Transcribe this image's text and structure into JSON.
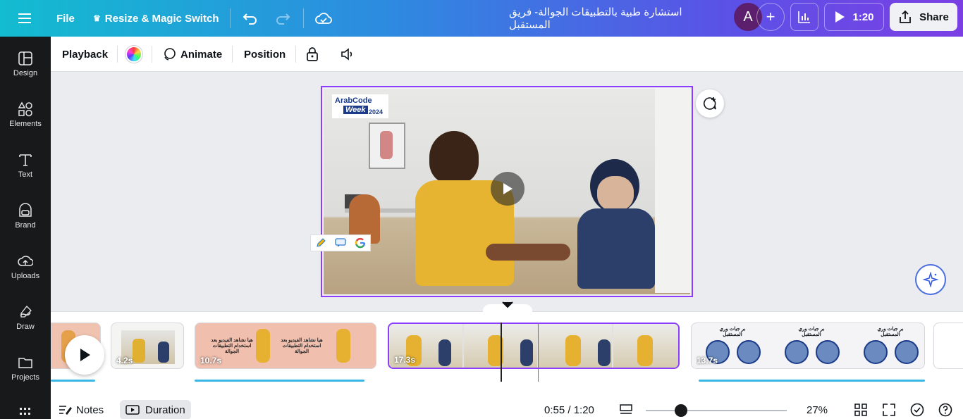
{
  "topbar": {
    "menu_icon": "hamburger-icon",
    "file_label": "File",
    "resize_label": "Resize & Magic Switch",
    "design_title": "استشارة طبية بالتطبيقات الجوالة- فريق المستقبل",
    "avatar_letter": "A",
    "play_time": "1:20",
    "share_label": "Share",
    "gradient_start": "#13bcd0",
    "gradient_end": "#7b3fe4"
  },
  "sidebar": {
    "items": [
      {
        "label": "Design",
        "icon": "design-icon"
      },
      {
        "label": "Elements",
        "icon": "elements-icon"
      },
      {
        "label": "Text",
        "icon": "text-icon"
      },
      {
        "label": "Brand",
        "icon": "brand-icon"
      },
      {
        "label": "Uploads",
        "icon": "uploads-icon"
      },
      {
        "label": "Draw",
        "icon": "draw-icon"
      },
      {
        "label": "Projects",
        "icon": "projects-icon"
      }
    ]
  },
  "context_toolbar": {
    "playback_label": "Playback",
    "animate_label": "Animate",
    "position_label": "Position"
  },
  "canvas": {
    "logo_text_1": "ArabCode",
    "logo_text_2": "Week",
    "logo_year": "2024"
  },
  "timeline": {
    "clips": [
      {
        "duration": ""
      },
      {
        "duration": "4.2s"
      },
      {
        "duration": "10.7s"
      },
      {
        "duration": "17.3s"
      },
      {
        "duration": "13.7s"
      }
    ],
    "clip3_text": "هيا نشاهد الفيديو بعد استخدام التطبيقات الجوالة",
    "clip5_text": "بر جيات وري المستقبل"
  },
  "bottombar": {
    "notes_label": "Notes",
    "duration_label": "Duration",
    "time_display": "0:55 / 1:20",
    "zoom_level": "27%",
    "zoom_fraction": 0.27
  },
  "colors": {
    "accent": "#8b3dff",
    "audio_bar": "#3ab6e6",
    "sidebar_bg": "#18191b"
  }
}
